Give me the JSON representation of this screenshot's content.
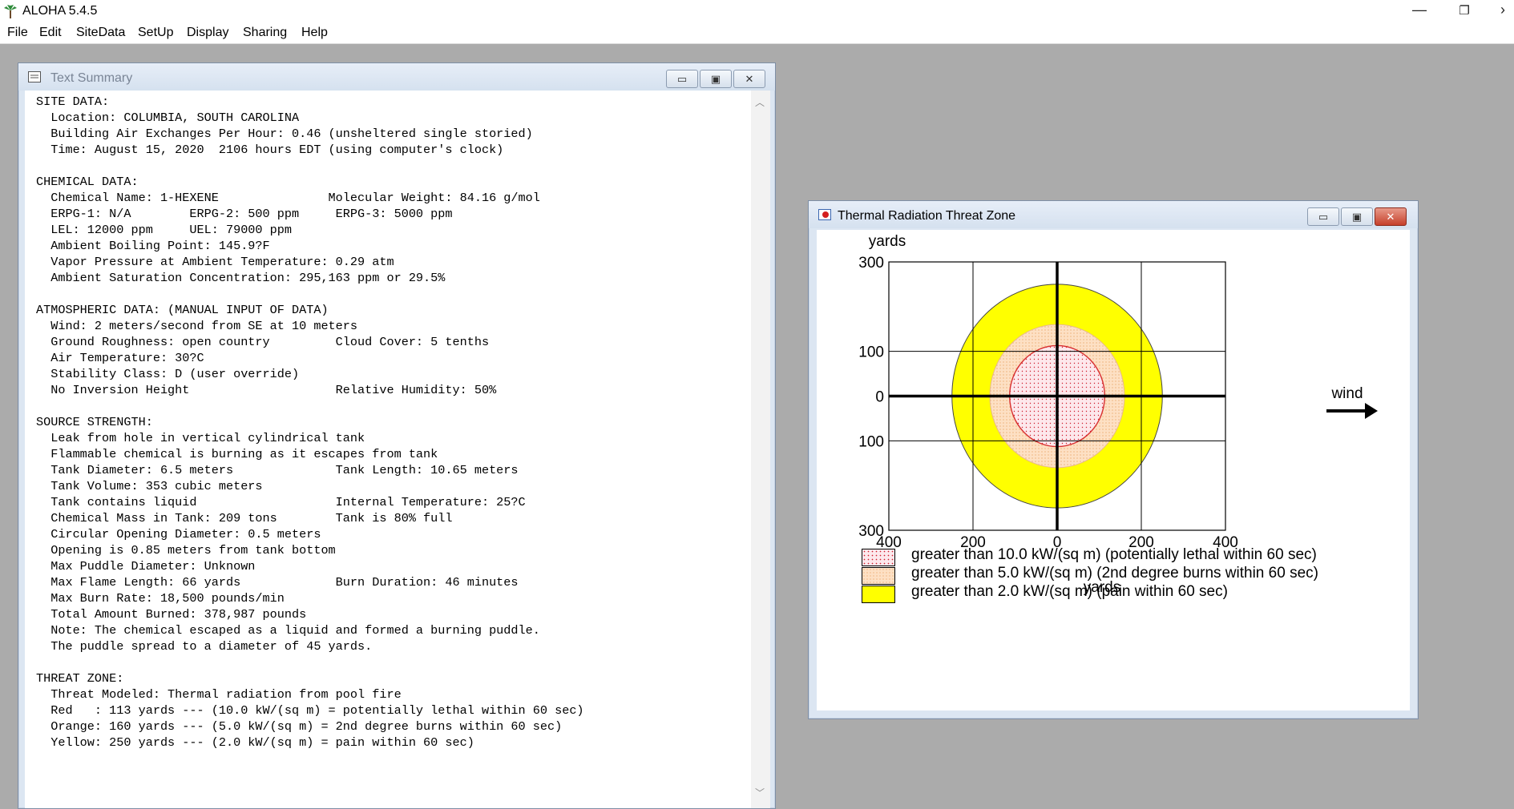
{
  "app": {
    "title": "ALOHA 5.4.5"
  },
  "window_controls": {
    "minimize": "—",
    "restore": "❐",
    "close": "›"
  },
  "menu": [
    "File",
    "Edit",
    "SiteData",
    "SetUp",
    "Display",
    "Sharing",
    "Help"
  ],
  "text_summary": {
    "title": "Text Summary",
    "lines": [
      "SITE DATA:",
      "  Location: COLUMBIA, SOUTH CAROLINA",
      "  Building Air Exchanges Per Hour: 0.46 (unsheltered single storied)",
      "  Time: August 15, 2020  2106 hours EDT (using computer's clock)",
      "",
      "CHEMICAL DATA:",
      "  Chemical Name: 1-HEXENE               Molecular Weight: 84.16 g/mol",
      "  ERPG-1: N/A        ERPG-2: 500 ppm     ERPG-3: 5000 ppm",
      "  LEL: 12000 ppm     UEL: 79000 ppm",
      "  Ambient Boiling Point: 145.9?F",
      "  Vapor Pressure at Ambient Temperature: 0.29 atm",
      "  Ambient Saturation Concentration: 295,163 ppm or 29.5%",
      "",
      "ATMOSPHERIC DATA: (MANUAL INPUT OF DATA)",
      "  Wind: 2 meters/second from SE at 10 meters",
      "  Ground Roughness: open country         Cloud Cover: 5 tenths",
      "  Air Temperature: 30?C",
      "  Stability Class: D (user override)",
      "  No Inversion Height                    Relative Humidity: 50%",
      "",
      "SOURCE STRENGTH:",
      "  Leak from hole in vertical cylindrical tank",
      "  Flammable chemical is burning as it escapes from tank",
      "  Tank Diameter: 6.5 meters              Tank Length: 10.65 meters",
      "  Tank Volume: 353 cubic meters",
      "  Tank contains liquid                   Internal Temperature: 25?C",
      "  Chemical Mass in Tank: 209 tons        Tank is 80% full",
      "  Circular Opening Diameter: 0.5 meters",
      "  Opening is 0.85 meters from tank bottom",
      "  Max Puddle Diameter: Unknown",
      "  Max Flame Length: 66 yards             Burn Duration: 46 minutes",
      "  Max Burn Rate: 18,500 pounds/min",
      "  Total Amount Burned: 378,987 pounds",
      "  Note: The chemical escaped as a liquid and formed a burning puddle.",
      "  The puddle spread to a diameter of 45 yards.",
      "",
      "THREAT ZONE:",
      "  Threat Modeled: Thermal radiation from pool fire",
      "  Red   : 113 yards --- (10.0 kW/(sq m) = potentially lethal within 60 sec)",
      "  Orange: 160 yards --- (5.0 kW/(sq m) = 2nd degree burns within 60 sec)",
      "  Yellow: 250 yards --- (2.0 kW/(sq m) = pain within 60 sec)"
    ]
  },
  "threat_window": {
    "title": "Thermal Radiation Threat Zone",
    "wind_label": "wind"
  },
  "chart_data": {
    "type": "threat-zone",
    "xlabel": "yards",
    "ylabel": "yards",
    "xlim": [
      -400,
      400
    ],
    "ylim": [
      -300,
      300
    ],
    "x_ticks": [
      {
        "value": -400,
        "label": "400"
      },
      {
        "value": -200,
        "label": "200"
      },
      {
        "value": 0,
        "label": "0"
      },
      {
        "value": 200,
        "label": "200"
      },
      {
        "value": 400,
        "label": "400"
      }
    ],
    "y_ticks": [
      {
        "value": 300,
        "label": "300"
      },
      {
        "value": 100,
        "label": "100"
      },
      {
        "value": 0,
        "label": "0"
      },
      {
        "value": -100,
        "label": "100"
      },
      {
        "value": -300,
        "label": "300"
      }
    ],
    "zones": [
      {
        "radius": 250,
        "color": "#ffff00",
        "label": "greater than 2.0 kW/(sq m) (pain within 60 sec)"
      },
      {
        "radius": 160,
        "color": "#fde0c4",
        "label": "greater than 5.0 kW/(sq m) (2nd degree burns within 60 sec)"
      },
      {
        "radius": 113,
        "color": "#fde8ec",
        "label": "greater than 10.0 kW/(sq m) (potentially lethal within 60 sec)"
      }
    ],
    "legend_order": [
      2,
      1,
      0
    ]
  }
}
